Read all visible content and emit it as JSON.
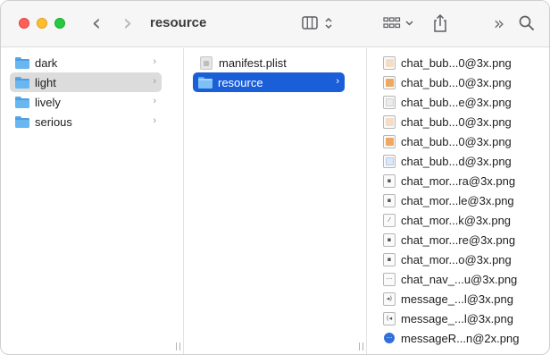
{
  "window": {
    "title": "resource"
  },
  "toolbar": {
    "back_glyph": "‹",
    "forward_glyph": "›",
    "more_glyph": "»"
  },
  "column1": {
    "items": [
      {
        "label": "dark",
        "icon": "folder-icon",
        "selected": false
      },
      {
        "label": "light",
        "icon": "folder-icon",
        "selected": true
      },
      {
        "label": "lively",
        "icon": "folder-icon",
        "selected": false
      },
      {
        "label": "serious",
        "icon": "folder-icon",
        "selected": false
      }
    ]
  },
  "column2": {
    "items": [
      {
        "label": "manifest.plist",
        "icon": "plist-file-icon",
        "selected": false
      },
      {
        "label": "resource",
        "icon": "folder-icon",
        "selected": true
      }
    ]
  },
  "column3": {
    "items": [
      {
        "label": "chat_bub...0@3x.png",
        "icon": "orange-bubble-thumb-icon",
        "thumb_color": "#f5dcc4"
      },
      {
        "label": "chat_bub...0@3x.png",
        "icon": "orange-bubble-thumb-icon",
        "thumb_color": "#f0a860"
      },
      {
        "label": "chat_bub...e@3x.png",
        "icon": "gray-bubble-thumb-icon",
        "thumb_color": "#ececec"
      },
      {
        "label": "chat_bub...0@3x.png",
        "icon": "orange-bubble-thumb-icon",
        "thumb_color": "#f5dcc4"
      },
      {
        "label": "chat_bub...0@3x.png",
        "icon": "orange-bubble-thumb-icon",
        "thumb_color": "#f0a860"
      },
      {
        "label": "chat_bub...d@3x.png",
        "icon": "blue-bubble-thumb-icon",
        "thumb_color": "#dfe7f7"
      },
      {
        "label": "chat_mor...ra@3x.png",
        "icon": "more-thumb-icon",
        "glyph": "▪"
      },
      {
        "label": "chat_mor...le@3x.png",
        "icon": "more-thumb-icon",
        "glyph": "▪"
      },
      {
        "label": "chat_mor...k@3x.png",
        "icon": "more-thumb-icon",
        "glyph": "⁄"
      },
      {
        "label": "chat_mor...re@3x.png",
        "icon": "more-thumb-icon",
        "glyph": "▪"
      },
      {
        "label": "chat_mor...o@3x.png",
        "icon": "more-thumb-icon",
        "glyph": "▪"
      },
      {
        "label": "chat_nav_...u@3x.png",
        "icon": "nav-thumb-icon",
        "glyph": "···"
      },
      {
        "label": "message_...l@3x.png",
        "icon": "voice-thumb-icon",
        "glyph": "◂)"
      },
      {
        "label": "message_...l@3x.png",
        "icon": "voice-thumb-icon",
        "glyph": "(◂"
      },
      {
        "label": "messageR...n@2x.png",
        "icon": "blue-round-thumb-icon",
        "glyph": "···"
      }
    ]
  },
  "colors": {
    "selection_blue": "#1a5fd8",
    "selection_gray": "#dcdcdc",
    "folder_blue": "#68b7f0"
  }
}
